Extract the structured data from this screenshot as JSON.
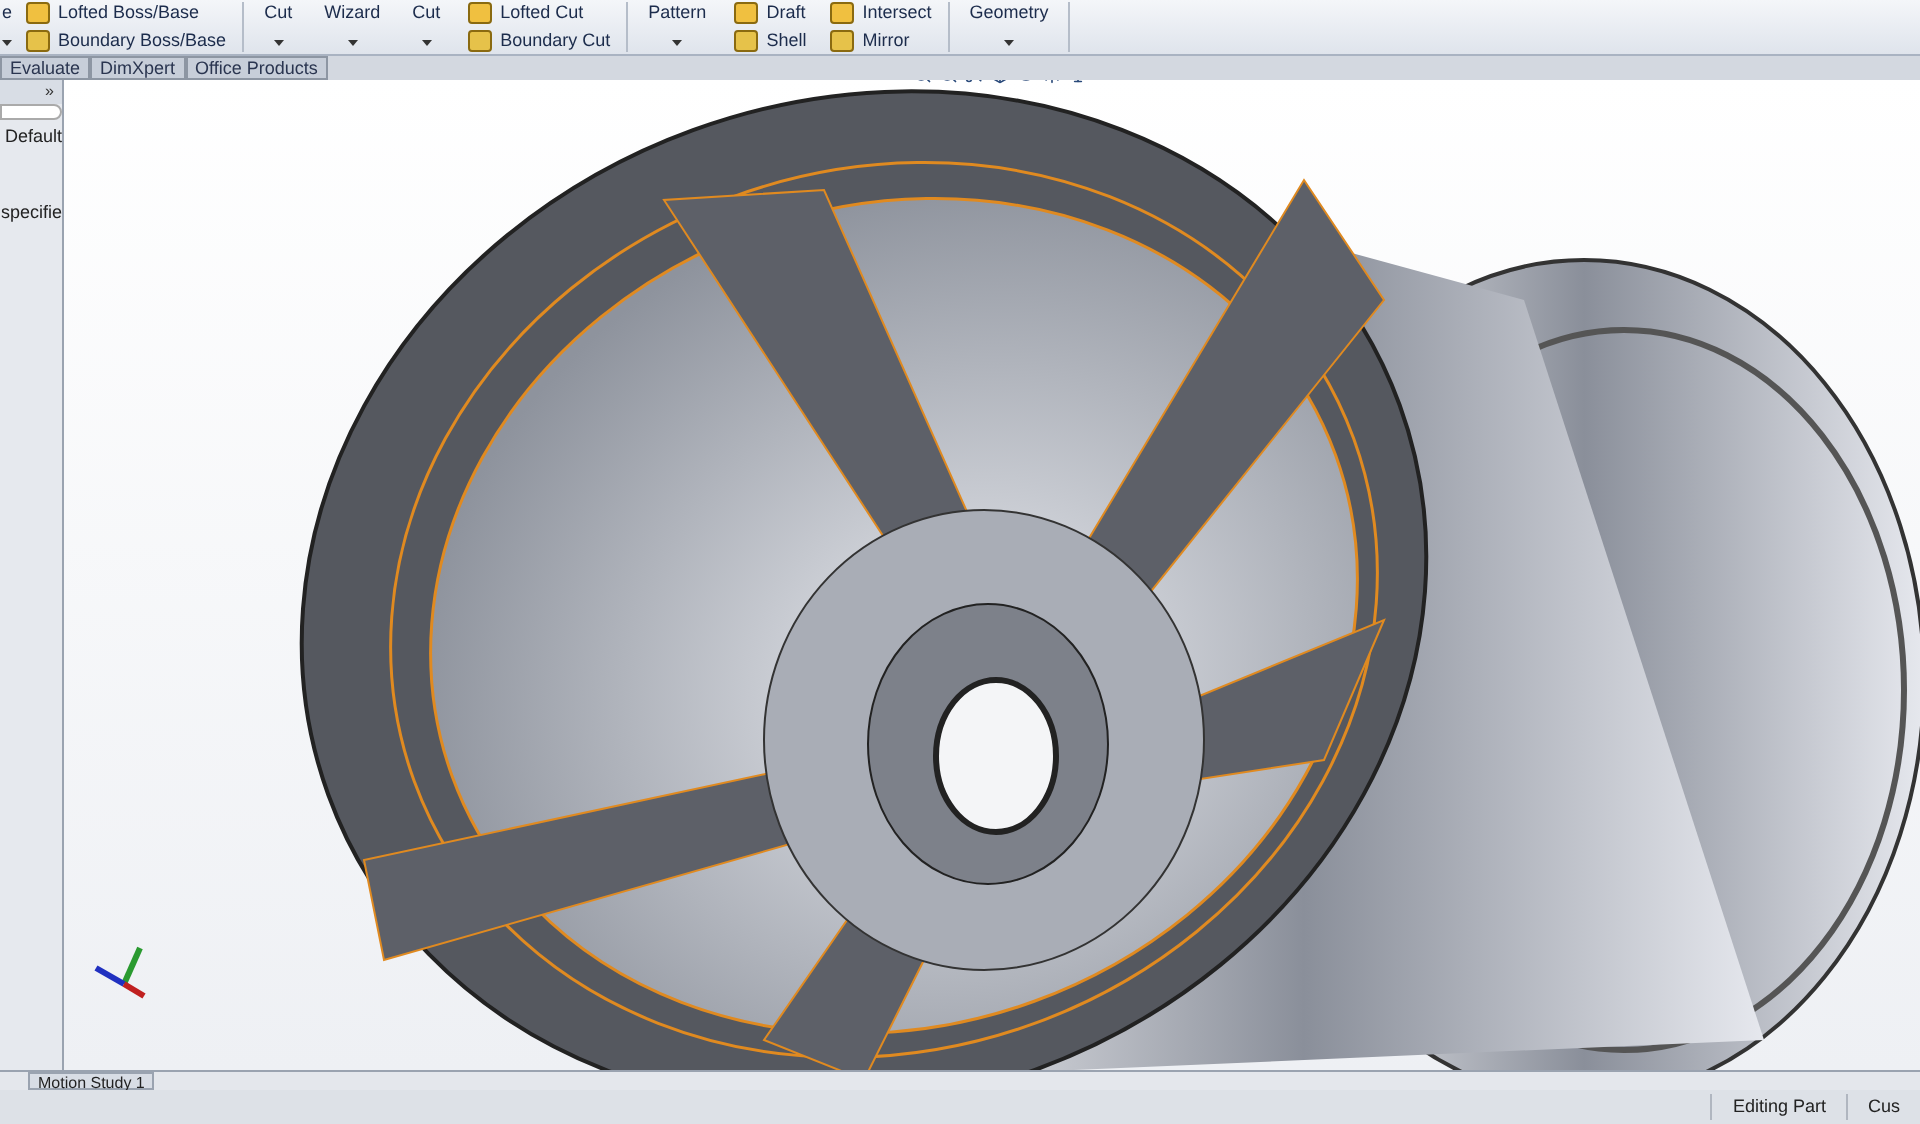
{
  "toolbar": [
    {
      "kind": "big",
      "label": "e"
    },
    {
      "kind": "stack",
      "items": [
        {
          "label": "Lofted Boss/Base"
        },
        {
          "label": "Boundary Boss/Base"
        }
      ]
    },
    {
      "kind": "divider"
    },
    {
      "kind": "big",
      "label": "Cut"
    },
    {
      "kind": "big",
      "label": "Wizard"
    },
    {
      "kind": "big",
      "label": "Cut"
    },
    {
      "kind": "stack",
      "items": [
        {
          "label": "Lofted Cut"
        },
        {
          "label": "Boundary Cut"
        }
      ]
    },
    {
      "kind": "divider"
    },
    {
      "kind": "big",
      "label": "Pattern"
    },
    {
      "kind": "stack",
      "items": [
        {
          "label": "Draft"
        },
        {
          "label": "Shell"
        }
      ]
    },
    {
      "kind": "stack",
      "items": [
        {
          "label": "Intersect"
        },
        {
          "label": "Mirror"
        }
      ]
    },
    {
      "kind": "divider"
    },
    {
      "kind": "big",
      "label": "Geometry"
    },
    {
      "kind": "divider"
    }
  ],
  "command_tabs": [
    {
      "label": "Evaluate",
      "selected": false
    },
    {
      "label": "DimXpert",
      "selected": false
    },
    {
      "label": "Office Products",
      "selected": false
    }
  ],
  "left_panel": {
    "collapse": "»",
    "lines": [
      "Default",
      "specifie"
    ]
  },
  "bottom_tabs": [
    {
      "label": "Motion Study 1",
      "selected": false
    }
  ],
  "status_bar": [
    "Editing Part",
    "Cus"
  ]
}
